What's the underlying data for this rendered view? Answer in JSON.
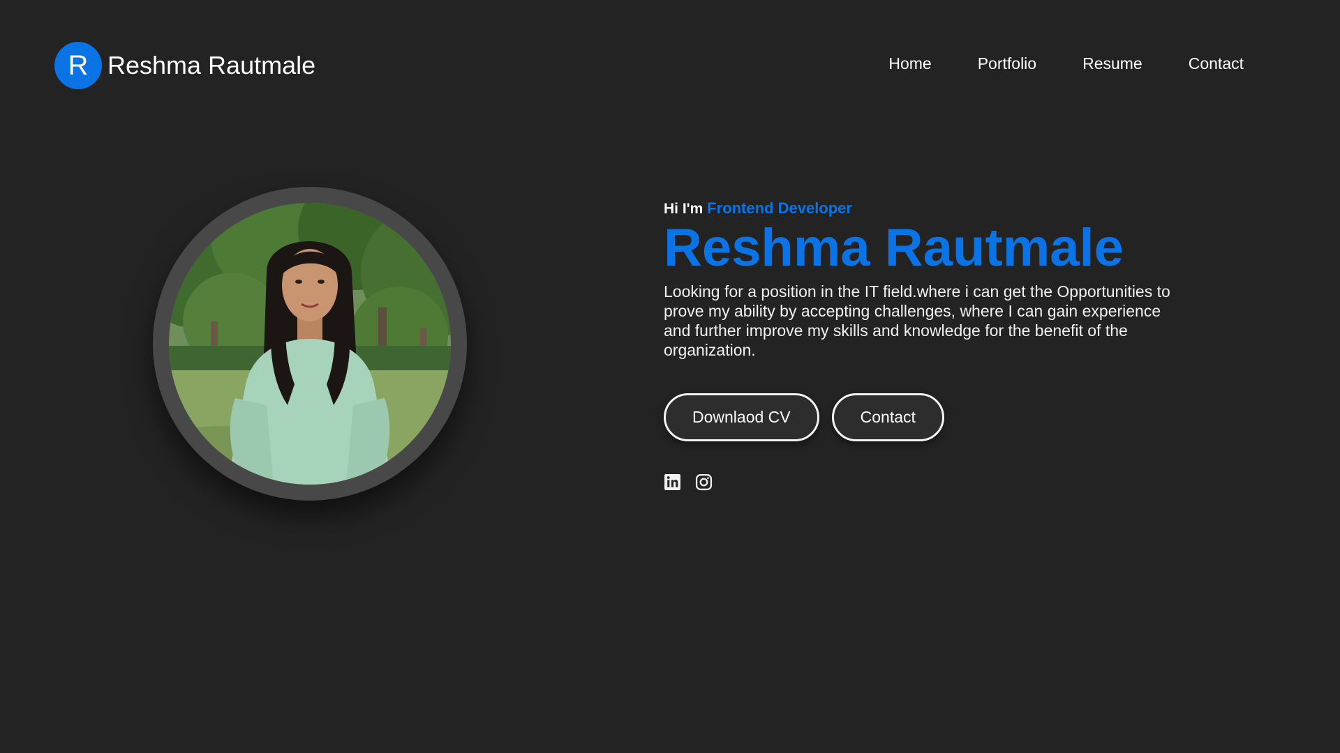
{
  "header": {
    "logo_letter": "R",
    "brand_name": "Reshma Rautmale",
    "nav": [
      {
        "label": "Home"
      },
      {
        "label": "Portfolio"
      },
      {
        "label": "Resume"
      },
      {
        "label": "Contact"
      }
    ]
  },
  "hero": {
    "greeting": "Hi I'm ",
    "role": "Frontend Developer",
    "name": "Reshma Rautmale",
    "summary": "Looking for a position in the IT field.where i can get the Opportunities to prove my ability by accepting challenges, where I can gain experience and further improve my skills and knowledge for the benefit of the organization.",
    "buttons": {
      "download_label": "Downlaod CV",
      "contact_label": "Contact"
    },
    "socials": [
      {
        "icon": "linkedin-icon"
      },
      {
        "icon": "instagram-icon"
      }
    ]
  },
  "colors": {
    "background": "#232323",
    "accent": "#0a74e6",
    "text": "#ffffff",
    "ring": "#484848"
  }
}
